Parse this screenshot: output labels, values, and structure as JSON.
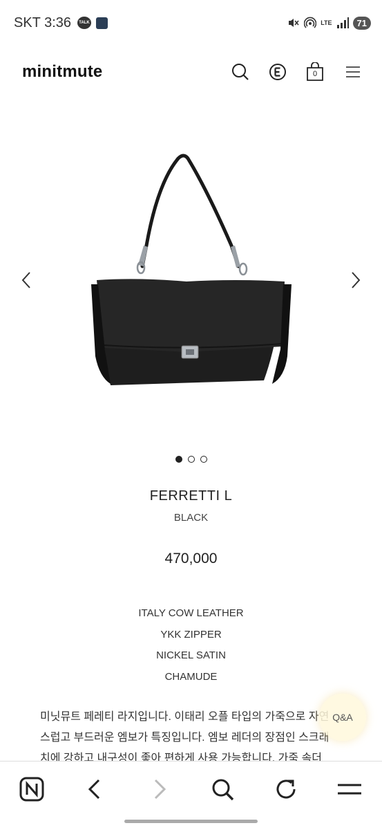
{
  "status_bar": {
    "carrier_time": "SKT 3:36",
    "talk_badge": "TALK",
    "network": "LTE",
    "battery": "71"
  },
  "header": {
    "logo": "minitmute",
    "cart_count": "0",
    "icons": [
      "search-icon",
      "e-badge-icon",
      "cart-icon",
      "menu-icon"
    ]
  },
  "gallery": {
    "slide_count": 3,
    "active_slide": 1
  },
  "product": {
    "name": "FERRETTI L",
    "color": "BLACK",
    "price": "470,000",
    "specs": [
      "ITALY COW LEATHER",
      "YKK ZIPPER",
      "NICKEL SATIN",
      "CHAMUDE"
    ],
    "description_lines": [
      "미닛뮤트 페레티 라지입니다. 이태리 오플 타입의 가죽으로 자연",
      "스럽고 부드러운 엠보가 특징입니다. 엠보 레더의 장점인 스크래",
      "치에 강하고 내구성이 좋아 편하게 사용 가능합니다. 가죽 속더"
    ]
  },
  "qa_button": "Q&A",
  "bottom_nav": {
    "icons": [
      "naver-home-icon",
      "back-arrow-icon",
      "forward-arrow-icon",
      "search-icon",
      "refresh-icon",
      "menu-icon"
    ]
  }
}
